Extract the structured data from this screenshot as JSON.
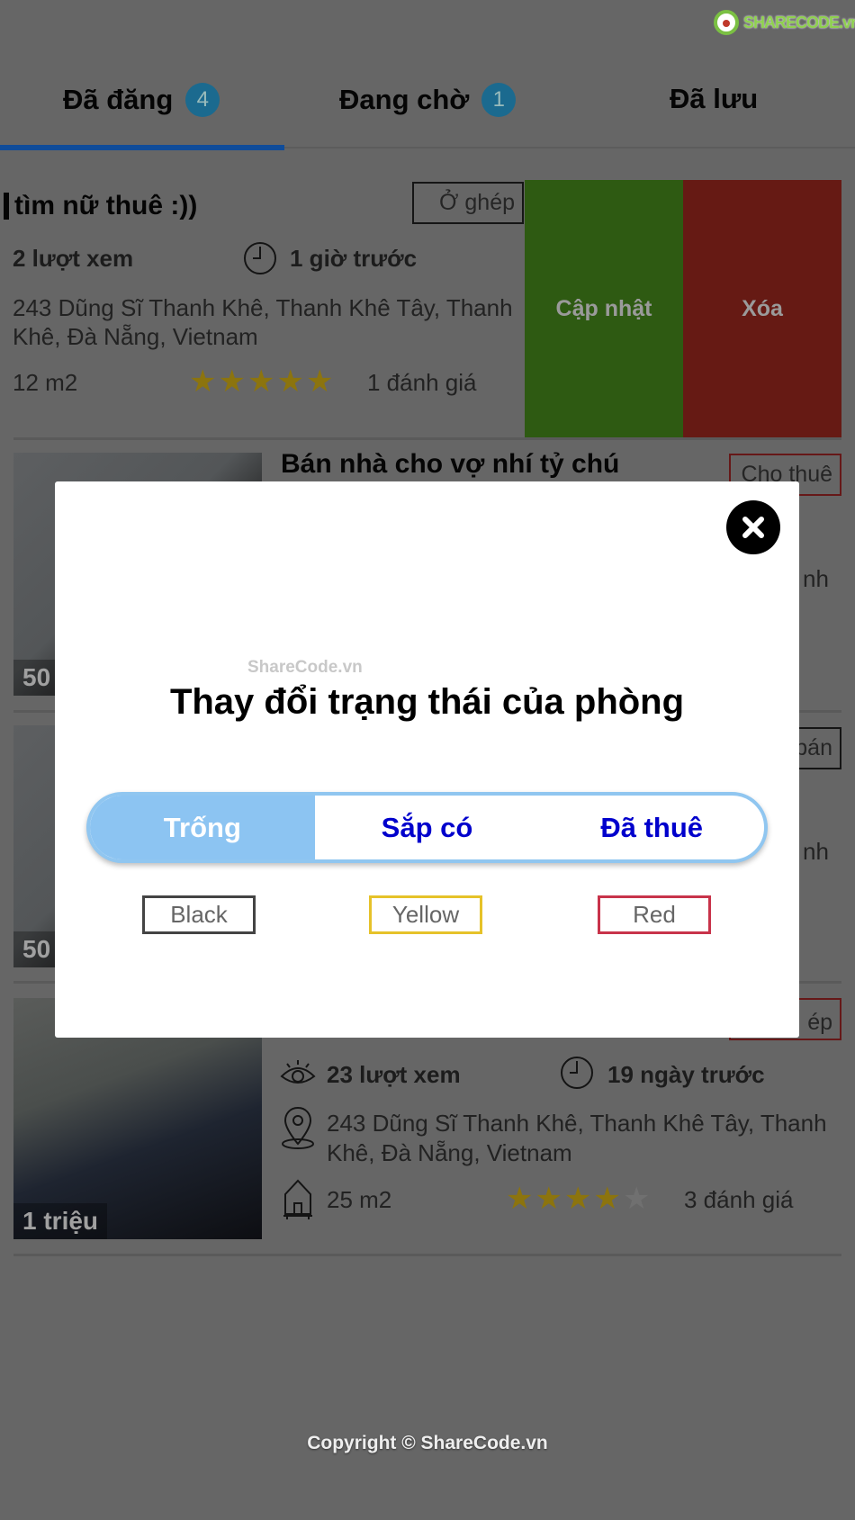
{
  "logo": "SHARECODE.vn",
  "tabs": [
    {
      "label": "Đã đăng",
      "count": "4",
      "active": true
    },
    {
      "label": "Đang chờ",
      "count": "1"
    },
    {
      "label": "Đã lưu"
    }
  ],
  "cards": [
    {
      "title": "tìm nữ thuê :))",
      "type": "Ở ghép",
      "views": "2 lượt xem",
      "time": "1 giờ trước",
      "address_line1": "243 Dũng Sĩ Thanh Khê, Thanh Khê Tây, Thanh",
      "address_line2": "Khê, Đà Nẵng, Vietnam",
      "area": "12  m2",
      "rating": 5,
      "reviews": "1 đánh giá",
      "actions": {
        "update": "Cập nhật",
        "delete": "Xóa"
      }
    },
    {
      "title": "Bán nhà cho vợ nhí tỷ chú",
      "type": "Cho thuê",
      "price": "50",
      "address_tail": "nh"
    },
    {
      "type": "bán",
      "price": "50",
      "address_tail": "nh"
    },
    {
      "type": "ép",
      "price": "1 triệu",
      "views": "23 lượt xem",
      "time": "19 ngày trước",
      "address_line1": "243 Dũng Sĩ Thanh Khê, Thanh Khê Tây, Thanh",
      "address_line2": "Khê, Đà Nẵng, Vietnam",
      "area": "25  m2",
      "rating": 4,
      "reviews": "3 đánh giá"
    }
  ],
  "footer": "Copyright © ShareCode.vn",
  "modal": {
    "watermark": "ShareCode.vn",
    "title": "Thay đổi trạng thái của phòng",
    "segments": [
      "Trống",
      "Sắp có",
      "Đã thuê"
    ],
    "selected": "Trống",
    "color_buttons": [
      {
        "label": "Black",
        "color": "#444444"
      },
      {
        "label": "Yellow",
        "color": "#e6c229"
      },
      {
        "label": "Red",
        "color": "#c8334a"
      }
    ]
  },
  "colors": {
    "accent": "#1565c0",
    "update": "#73e12d",
    "delete": "#ff4232",
    "star": "#ffd21a",
    "star_empty": "#cccccc",
    "selected_segment": "#8cc4f2"
  }
}
